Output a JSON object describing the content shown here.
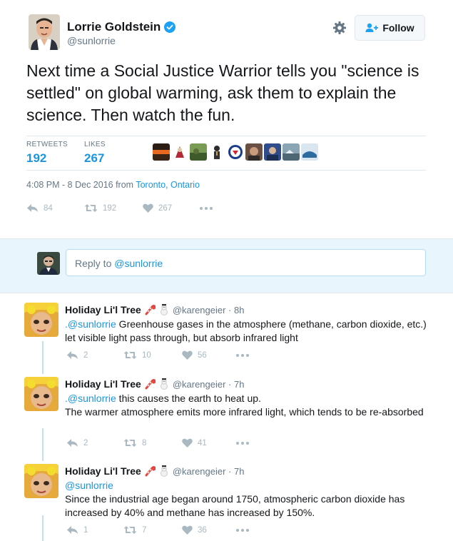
{
  "tweet": {
    "author_name": "Lorrie Goldstein",
    "author_handle": "@sunlorrie",
    "follow_label": "Follow",
    "text": "Next time a Social Justice Warrior tells you \"science is settled\" on global warming, ask them to explain the science. Then watch the fun.",
    "retweets_label": "RETWEETS",
    "retweets_count": "192",
    "likes_label": "LIKES",
    "likes_count": "267",
    "timestamp": "4:08 PM - 8 Dec 2016 from ",
    "location": "Toronto, Ontario",
    "actions": {
      "reply": "84",
      "retweet": "192",
      "like": "267"
    }
  },
  "reply_composer": {
    "prefix": "Reply to ",
    "mention": "@sunlorrie"
  },
  "replies": [
    {
      "name": "Holiday Li'l Tree",
      "handle": "@karengeier · 8h",
      "mention": ".@sunlorrie",
      "text": " Greenhouse gases in the atmosphere (methane, carbon dioxide, etc.) let visible light pass through, but absorb infrared light",
      "reply": "2",
      "retweet": "10",
      "like": "56"
    },
    {
      "name": "Holiday Li'l Tree",
      "handle": "@karengeier · 7h",
      "mention": ".@sunlorrie",
      "text": " this causes the earth to heat up.",
      "text2": "The warmer atmosphere emits more infrared light, which tends to be re-absorbed",
      "reply": "2",
      "retweet": "8",
      "like": "41"
    },
    {
      "name": "Holiday Li'l Tree",
      "handle": "@karengeier · 7h",
      "mention": "@sunlorrie",
      "text": "Since the industrial age began around 1750, atmospheric carbon dioxide has increased by 40% and methane has increased by 150%.",
      "reply": "1",
      "retweet": "7",
      "like": "36"
    }
  ],
  "colors": {
    "link": "#1b95e0",
    "secondary": "#657786",
    "action_gray": "#aab8c2",
    "reply_bg": "#e8f5fd"
  }
}
